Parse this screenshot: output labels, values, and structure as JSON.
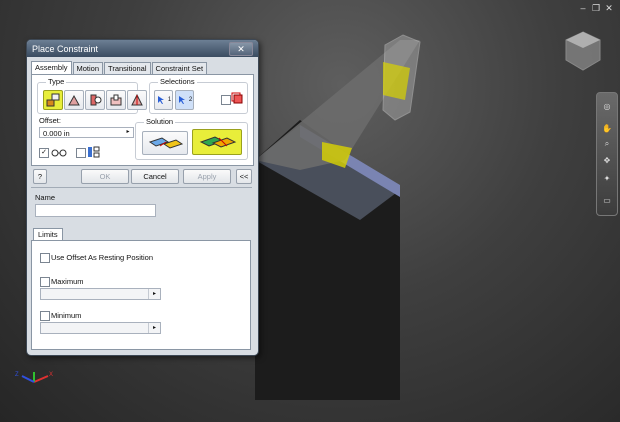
{
  "window_controls": [
    "–",
    "❐",
    "✕"
  ],
  "dialog": {
    "title": "Place Constraint",
    "close_label": "✕",
    "tabs": [
      "Assembly",
      "Motion",
      "Transitional",
      "Constraint Set"
    ],
    "active_tab": "Assembly",
    "type_label": "Type",
    "type_buttons": [
      "mate-icon",
      "angle-icon",
      "tangent-icon",
      "insert-icon",
      "symmetry-icon"
    ],
    "selected_type": "mate-icon",
    "selections_label": "Selections",
    "selection_buttons": [
      "1",
      "2"
    ],
    "offset_label": "Offset:",
    "offset_value": "0.000 in",
    "solution_label": "Solution",
    "solution_buttons": [
      "mate-solution-icon",
      "flush-solution-icon"
    ],
    "selected_solution": "flush-solution-icon",
    "show_preview_checked": true,
    "predict_offset_checked": false,
    "help_label": "?",
    "ok_label": "OK",
    "cancel_label": "Cancel",
    "apply_label": "Apply",
    "expand_label": "<<",
    "name_label": "Name",
    "name_value": "",
    "limits_tab": "Limits",
    "use_offset_label": "Use Offset As Resting Position",
    "maximum_label": "Maximum",
    "minimum_label": "Minimum",
    "maximum_value": "",
    "minimum_value": "",
    "colors": {
      "selected": "#e8ee3a",
      "titlebar": "#4a5d73"
    }
  },
  "triad": {
    "x": "X",
    "y": "Y",
    "z": "Z"
  }
}
